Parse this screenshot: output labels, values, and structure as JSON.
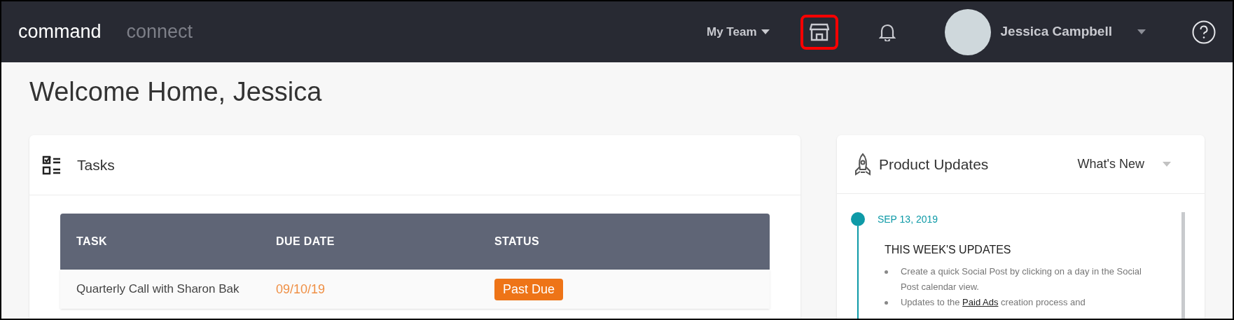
{
  "header": {
    "nav": [
      {
        "label": "command",
        "selected": true
      },
      {
        "label": "connect",
        "selected": false
      }
    ],
    "team_menu": "My Team",
    "store_button": {
      "highlighted": true
    },
    "user_name": "Jessica Campbell"
  },
  "page_title": "Welcome Home, Jessica",
  "tasks": {
    "title": "Tasks",
    "columns": [
      "TASK",
      "DUE DATE",
      "STATUS"
    ],
    "rows": [
      {
        "task": "Quarterly Call with Sharon Bak",
        "due": "09/10/19",
        "overdue": true,
        "status": "Past Due"
      }
    ]
  },
  "product_updates": {
    "title": "Product Updates",
    "filter": "What's New",
    "entries": [
      {
        "date": "SEP 13, 2019",
        "heading": "THIS WEEK'S UPDATES",
        "bullets": [
          {
            "before": "Create a quick Social Post by clicking on a day in the Social Post calendar view."
          },
          {
            "before": "Updates to the ",
            "link": "Paid Ads",
            "after": " creation process and"
          }
        ]
      }
    ]
  }
}
